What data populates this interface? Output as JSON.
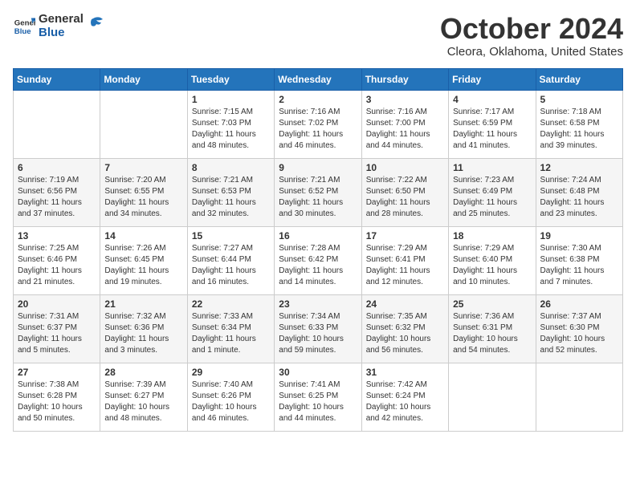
{
  "header": {
    "logo_general": "General",
    "logo_blue": "Blue",
    "month_year": "October 2024",
    "location": "Cleora, Oklahoma, United States"
  },
  "days_of_week": [
    "Sunday",
    "Monday",
    "Tuesday",
    "Wednesday",
    "Thursday",
    "Friday",
    "Saturday"
  ],
  "weeks": [
    [
      {
        "day": "",
        "content": ""
      },
      {
        "day": "",
        "content": ""
      },
      {
        "day": "1",
        "content": "Sunrise: 7:15 AM\nSunset: 7:03 PM\nDaylight: 11 hours and 48 minutes."
      },
      {
        "day": "2",
        "content": "Sunrise: 7:16 AM\nSunset: 7:02 PM\nDaylight: 11 hours and 46 minutes."
      },
      {
        "day": "3",
        "content": "Sunrise: 7:16 AM\nSunset: 7:00 PM\nDaylight: 11 hours and 44 minutes."
      },
      {
        "day": "4",
        "content": "Sunrise: 7:17 AM\nSunset: 6:59 PM\nDaylight: 11 hours and 41 minutes."
      },
      {
        "day": "5",
        "content": "Sunrise: 7:18 AM\nSunset: 6:58 PM\nDaylight: 11 hours and 39 minutes."
      }
    ],
    [
      {
        "day": "6",
        "content": "Sunrise: 7:19 AM\nSunset: 6:56 PM\nDaylight: 11 hours and 37 minutes."
      },
      {
        "day": "7",
        "content": "Sunrise: 7:20 AM\nSunset: 6:55 PM\nDaylight: 11 hours and 34 minutes."
      },
      {
        "day": "8",
        "content": "Sunrise: 7:21 AM\nSunset: 6:53 PM\nDaylight: 11 hours and 32 minutes."
      },
      {
        "day": "9",
        "content": "Sunrise: 7:21 AM\nSunset: 6:52 PM\nDaylight: 11 hours and 30 minutes."
      },
      {
        "day": "10",
        "content": "Sunrise: 7:22 AM\nSunset: 6:50 PM\nDaylight: 11 hours and 28 minutes."
      },
      {
        "day": "11",
        "content": "Sunrise: 7:23 AM\nSunset: 6:49 PM\nDaylight: 11 hours and 25 minutes."
      },
      {
        "day": "12",
        "content": "Sunrise: 7:24 AM\nSunset: 6:48 PM\nDaylight: 11 hours and 23 minutes."
      }
    ],
    [
      {
        "day": "13",
        "content": "Sunrise: 7:25 AM\nSunset: 6:46 PM\nDaylight: 11 hours and 21 minutes."
      },
      {
        "day": "14",
        "content": "Sunrise: 7:26 AM\nSunset: 6:45 PM\nDaylight: 11 hours and 19 minutes."
      },
      {
        "day": "15",
        "content": "Sunrise: 7:27 AM\nSunset: 6:44 PM\nDaylight: 11 hours and 16 minutes."
      },
      {
        "day": "16",
        "content": "Sunrise: 7:28 AM\nSunset: 6:42 PM\nDaylight: 11 hours and 14 minutes."
      },
      {
        "day": "17",
        "content": "Sunrise: 7:29 AM\nSunset: 6:41 PM\nDaylight: 11 hours and 12 minutes."
      },
      {
        "day": "18",
        "content": "Sunrise: 7:29 AM\nSunset: 6:40 PM\nDaylight: 11 hours and 10 minutes."
      },
      {
        "day": "19",
        "content": "Sunrise: 7:30 AM\nSunset: 6:38 PM\nDaylight: 11 hours and 7 minutes."
      }
    ],
    [
      {
        "day": "20",
        "content": "Sunrise: 7:31 AM\nSunset: 6:37 PM\nDaylight: 11 hours and 5 minutes."
      },
      {
        "day": "21",
        "content": "Sunrise: 7:32 AM\nSunset: 6:36 PM\nDaylight: 11 hours and 3 minutes."
      },
      {
        "day": "22",
        "content": "Sunrise: 7:33 AM\nSunset: 6:34 PM\nDaylight: 11 hours and 1 minute."
      },
      {
        "day": "23",
        "content": "Sunrise: 7:34 AM\nSunset: 6:33 PM\nDaylight: 10 hours and 59 minutes."
      },
      {
        "day": "24",
        "content": "Sunrise: 7:35 AM\nSunset: 6:32 PM\nDaylight: 10 hours and 56 minutes."
      },
      {
        "day": "25",
        "content": "Sunrise: 7:36 AM\nSunset: 6:31 PM\nDaylight: 10 hours and 54 minutes."
      },
      {
        "day": "26",
        "content": "Sunrise: 7:37 AM\nSunset: 6:30 PM\nDaylight: 10 hours and 52 minutes."
      }
    ],
    [
      {
        "day": "27",
        "content": "Sunrise: 7:38 AM\nSunset: 6:28 PM\nDaylight: 10 hours and 50 minutes."
      },
      {
        "day": "28",
        "content": "Sunrise: 7:39 AM\nSunset: 6:27 PM\nDaylight: 10 hours and 48 minutes."
      },
      {
        "day": "29",
        "content": "Sunrise: 7:40 AM\nSunset: 6:26 PM\nDaylight: 10 hours and 46 minutes."
      },
      {
        "day": "30",
        "content": "Sunrise: 7:41 AM\nSunset: 6:25 PM\nDaylight: 10 hours and 44 minutes."
      },
      {
        "day": "31",
        "content": "Sunrise: 7:42 AM\nSunset: 6:24 PM\nDaylight: 10 hours and 42 minutes."
      },
      {
        "day": "",
        "content": ""
      },
      {
        "day": "",
        "content": ""
      }
    ]
  ]
}
